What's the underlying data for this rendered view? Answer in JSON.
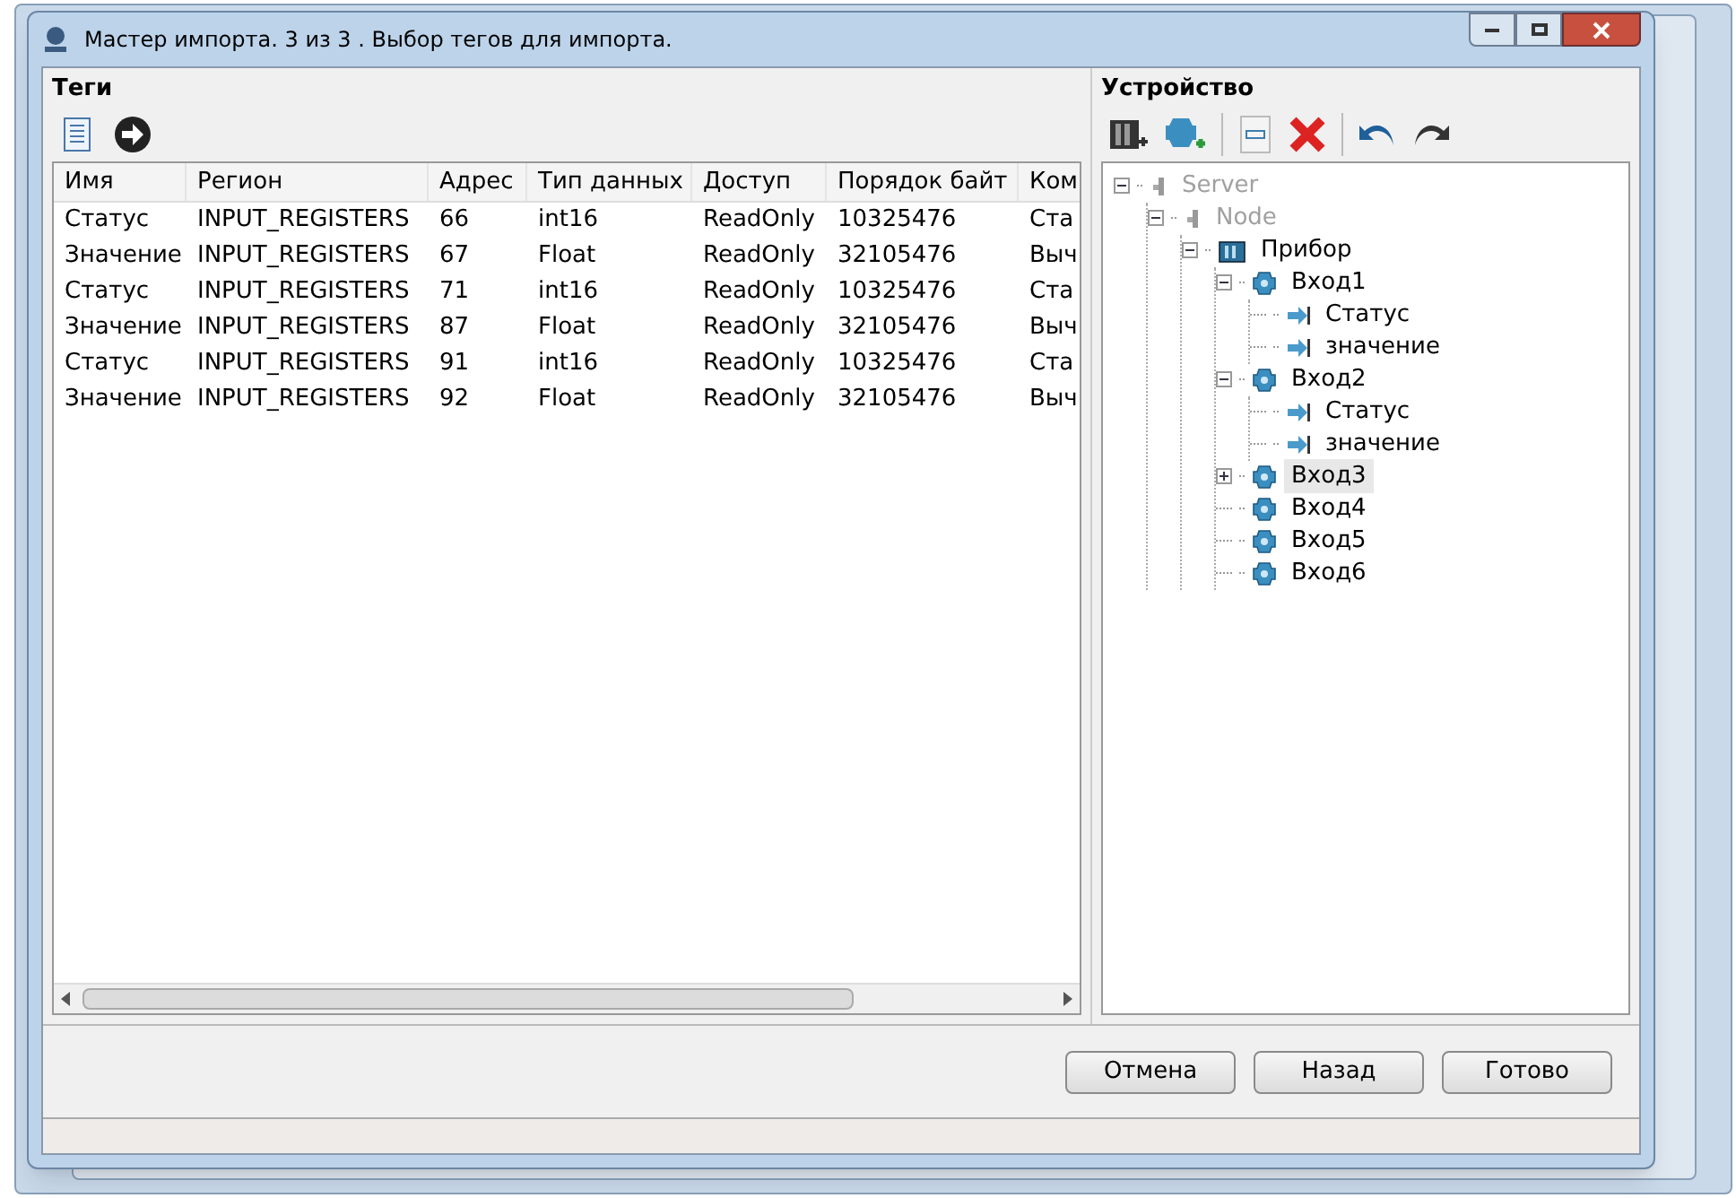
{
  "window": {
    "title": "Мастер импорта. 3 из 3 . Выбор тегов для импорта."
  },
  "tags_panel": {
    "title": "Теги",
    "table": {
      "columns": [
        "Имя",
        "Регион",
        "Адрес",
        "Тип данных",
        "Доступ",
        "Порядок байт",
        "Ком"
      ],
      "rows": [
        [
          "Статус",
          "INPUT_REGISTERS",
          "66",
          "int16",
          "ReadOnly",
          "10325476",
          "Ста"
        ],
        [
          "Значение",
          "INPUT_REGISTERS",
          "67",
          "Float",
          "ReadOnly",
          "32105476",
          "Выч"
        ],
        [
          "Статус",
          "INPUT_REGISTERS",
          "71",
          "int16",
          "ReadOnly",
          "10325476",
          "Ста"
        ],
        [
          "Значение",
          "INPUT_REGISTERS",
          "87",
          "Float",
          "ReadOnly",
          "32105476",
          "Выч"
        ],
        [
          "Статус",
          "INPUT_REGISTERS",
          "91",
          "int16",
          "ReadOnly",
          "10325476",
          "Ста"
        ],
        [
          "Значение",
          "INPUT_REGISTERS",
          "92",
          "Float",
          "ReadOnly",
          "32105476",
          "Выч"
        ]
      ]
    }
  },
  "device_panel": {
    "title": "Устройство",
    "tree": [
      {
        "label": "Server",
        "kind": "server",
        "disabled": true,
        "expanded": true,
        "selected": false,
        "children": [
          {
            "label": "Node",
            "kind": "node",
            "disabled": true,
            "expanded": true,
            "selected": false,
            "children": [
              {
                "label": "Прибор",
                "kind": "device",
                "disabled": false,
                "expanded": true,
                "selected": false,
                "children": [
                  {
                    "label": "Вход1",
                    "kind": "input",
                    "disabled": false,
                    "expanded": true,
                    "selected": false,
                    "children": [
                      {
                        "label": "Статус",
                        "kind": "tag",
                        "disabled": false,
                        "selected": false
                      },
                      {
                        "label": "значение",
                        "kind": "tag",
                        "disabled": false,
                        "selected": false
                      }
                    ]
                  },
                  {
                    "label": "Вход2",
                    "kind": "input",
                    "disabled": false,
                    "expanded": true,
                    "selected": false,
                    "children": [
                      {
                        "label": "Статус",
                        "kind": "tag",
                        "disabled": false,
                        "selected": false
                      },
                      {
                        "label": "значение",
                        "kind": "tag",
                        "disabled": false,
                        "selected": false
                      }
                    ]
                  },
                  {
                    "label": "Вход3",
                    "kind": "input",
                    "disabled": false,
                    "expanded": false,
                    "selected": true
                  },
                  {
                    "label": "Вход4",
                    "kind": "input",
                    "disabled": false,
                    "selected": false
                  },
                  {
                    "label": "Вход5",
                    "kind": "input",
                    "disabled": false,
                    "selected": false
                  },
                  {
                    "label": "Вход6",
                    "kind": "input",
                    "disabled": false,
                    "selected": false
                  }
                ]
              }
            ]
          }
        ]
      }
    ]
  },
  "buttons": [
    "Отмена",
    "Назад",
    "Готово"
  ]
}
